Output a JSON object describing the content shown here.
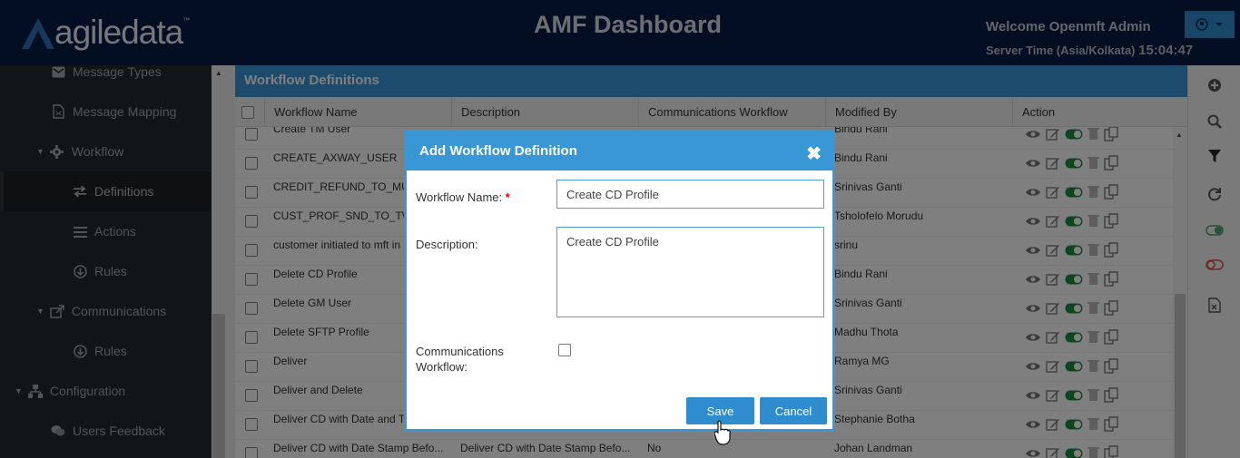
{
  "header": {
    "logo_text": "agiledata",
    "title": "AMF Dashboard",
    "welcome": "Welcome Openmft Admin",
    "server_time_label": "Server Time (Asia/Kolkata)",
    "server_time": "15:04:47"
  },
  "sidebar": {
    "items": [
      {
        "label": "Message Types",
        "icon": "envelope-icon"
      },
      {
        "label": "Message Mapping",
        "icon": "mapping-file-icon"
      },
      {
        "label": "Workflow",
        "icon": "gear-icon"
      },
      {
        "label": "Definitions",
        "icon": "exchange-arrows-icon"
      },
      {
        "label": "Actions",
        "icon": "list-icon"
      },
      {
        "label": "Rules",
        "icon": "arrow-circle-icon"
      },
      {
        "label": "Communications",
        "icon": "share-icon"
      },
      {
        "label": "Rules",
        "icon": "arrow-circle-icon"
      },
      {
        "label": "Configuration",
        "icon": "sitemap-icon"
      },
      {
        "label": "Users Feedback",
        "icon": "chat-icon"
      }
    ]
  },
  "panel": {
    "title": "Workflow Definitions"
  },
  "table": {
    "columns": [
      "Workflow Name",
      "Description",
      "Communications Workflow",
      "Modified By",
      "Action"
    ],
    "rows": [
      {
        "name": "Create TM User",
        "desc": "",
        "comm": "",
        "by": "Bindu Rani"
      },
      {
        "name": "CREATE_AXWAY_USER",
        "desc": "",
        "comm": "",
        "by": "Bindu Rani"
      },
      {
        "name": "CREDIT_REFUND_TO_MULTI",
        "desc": "",
        "comm": "",
        "by": "Srinivas Ganti"
      },
      {
        "name": "CUST_PROF_SND_TO_TWO",
        "desc": "",
        "comm": "",
        "by": "Tsholofelo Morudu"
      },
      {
        "name": "customer initiated to mft in",
        "desc": "",
        "comm": "",
        "by": "srinu"
      },
      {
        "name": "Delete CD Profile",
        "desc": "",
        "comm": "",
        "by": "Bindu Rani"
      },
      {
        "name": "Delete GM User",
        "desc": "",
        "comm": "",
        "by": "Srinivas Ganti"
      },
      {
        "name": "Delete SFTP Profile",
        "desc": "",
        "comm": "",
        "by": "Madhu Thota"
      },
      {
        "name": "Deliver",
        "desc": "",
        "comm": "",
        "by": "Ramya MG"
      },
      {
        "name": "Deliver and Delete",
        "desc": "",
        "comm": "",
        "by": "Srinivas Ganti"
      },
      {
        "name": "Deliver CD with Date and T",
        "desc": "",
        "comm": "",
        "by": "Stephanie Botha"
      },
      {
        "name": "Deliver CD with Date Stamp Befo...",
        "desc": "Deliver CD with Date Stamp Befo...",
        "comm": "No",
        "by": "Johan Landman"
      }
    ]
  },
  "toolbar": {
    "icons": [
      "add-circle-icon",
      "search-icon",
      "filter-icon",
      "refresh-icon",
      "toggle-on-icon",
      "toggle-off-icon",
      "excel-export-icon"
    ]
  },
  "modal": {
    "title": "Add Workflow Definition",
    "name_label": "Workflow Name:",
    "required_mark": "*",
    "name_value": "Create CD Profile",
    "desc_label": "Description:",
    "desc_value": "Create CD Profile",
    "comm_label": "Communications Workflow:",
    "save_label": "Save",
    "cancel_label": "Cancel",
    "close_glyph": "✖"
  }
}
